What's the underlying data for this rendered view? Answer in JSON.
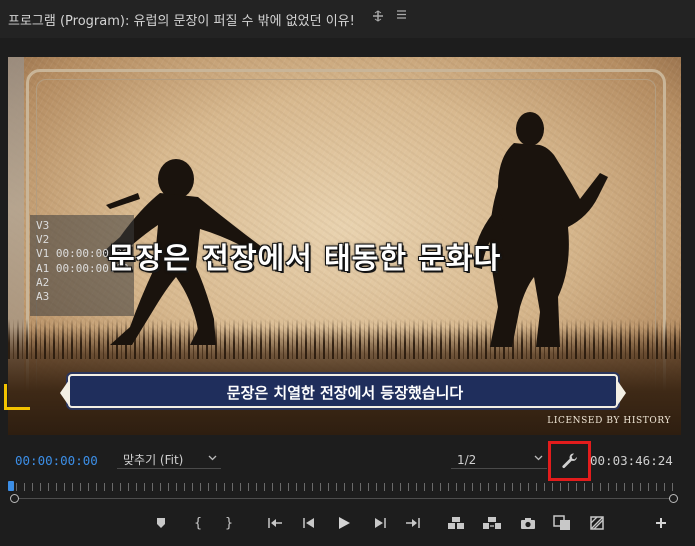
{
  "panel": {
    "title": "프로그램 (Program): 유럽의 문장이 퍼질 수 밖에 없었던 이유!",
    "menu_icon": "panel-menu-icon",
    "more_icon": "hamburger-icon"
  },
  "video": {
    "tracks": [
      "V3",
      "V2",
      "V1 00:00:00:00",
      "A1 00:00:00:00",
      "A2",
      "A3"
    ],
    "main_subtitle": "문장은 전장에서 태동한 문화다",
    "banner_subtitle": "문장은 치열한 전장에서 등장했습니다",
    "license": "LICENSED BY HISTORY"
  },
  "controls": {
    "current_timecode": "00:00:00:00",
    "zoom_label": "맞추기 (Fit)",
    "resolution_label": "1/2",
    "duration_timecode": "00:03:46:24",
    "settings_icon": "wrench-icon"
  },
  "transport": {
    "buttons": [
      {
        "name": "add-marker-button",
        "icon": "marker-icon"
      },
      {
        "name": "mark-in-button",
        "icon": "mark-in-icon",
        "glyph": "{"
      },
      {
        "name": "mark-out-button",
        "icon": "mark-out-icon",
        "glyph": "}"
      },
      {
        "name": "go-to-in-button",
        "icon": "go-to-in-icon"
      },
      {
        "name": "step-back-button",
        "icon": "step-back-icon"
      },
      {
        "name": "play-button",
        "icon": "play-icon"
      },
      {
        "name": "step-forward-button",
        "icon": "step-forward-icon"
      },
      {
        "name": "go-to-out-button",
        "icon": "go-to-out-icon"
      },
      {
        "name": "lift-button",
        "icon": "lift-icon"
      },
      {
        "name": "extract-button",
        "icon": "extract-icon"
      },
      {
        "name": "export-frame-button",
        "icon": "camera-icon"
      },
      {
        "name": "comparison-view-button",
        "icon": "comparison-icon"
      },
      {
        "name": "proxy-toggle-button",
        "icon": "proxy-icon"
      },
      {
        "name": "add-button",
        "icon": "plus-icon"
      }
    ]
  }
}
